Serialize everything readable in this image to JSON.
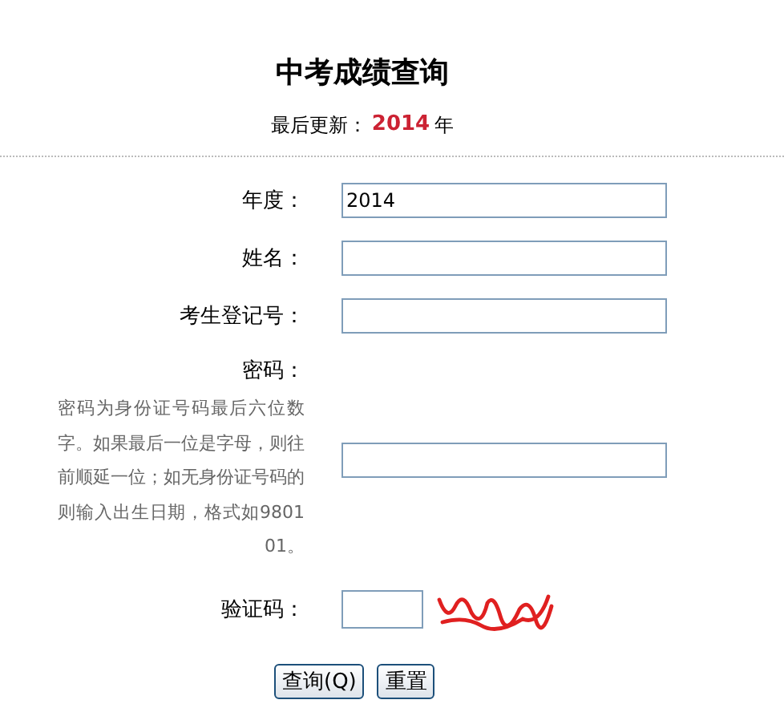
{
  "title": "中考成绩查询",
  "update": {
    "label": "最后更新：",
    "year": "2014",
    "unit": "年"
  },
  "fields": [
    {
      "label": "年度：",
      "value": "2014"
    },
    {
      "label": "姓名："
    },
    {
      "label": "考生登记号："
    },
    {
      "label": "密码：",
      "hint": "密码为身份证号码最后六位数字。如果最后一位是字母，则往前顺延一位；如无身份证号码的则输入出生日期，格式如980101。"
    }
  ],
  "captcha": {
    "label": "验证码："
  },
  "buttons": [
    "查询(Q)",
    "重置"
  ]
}
